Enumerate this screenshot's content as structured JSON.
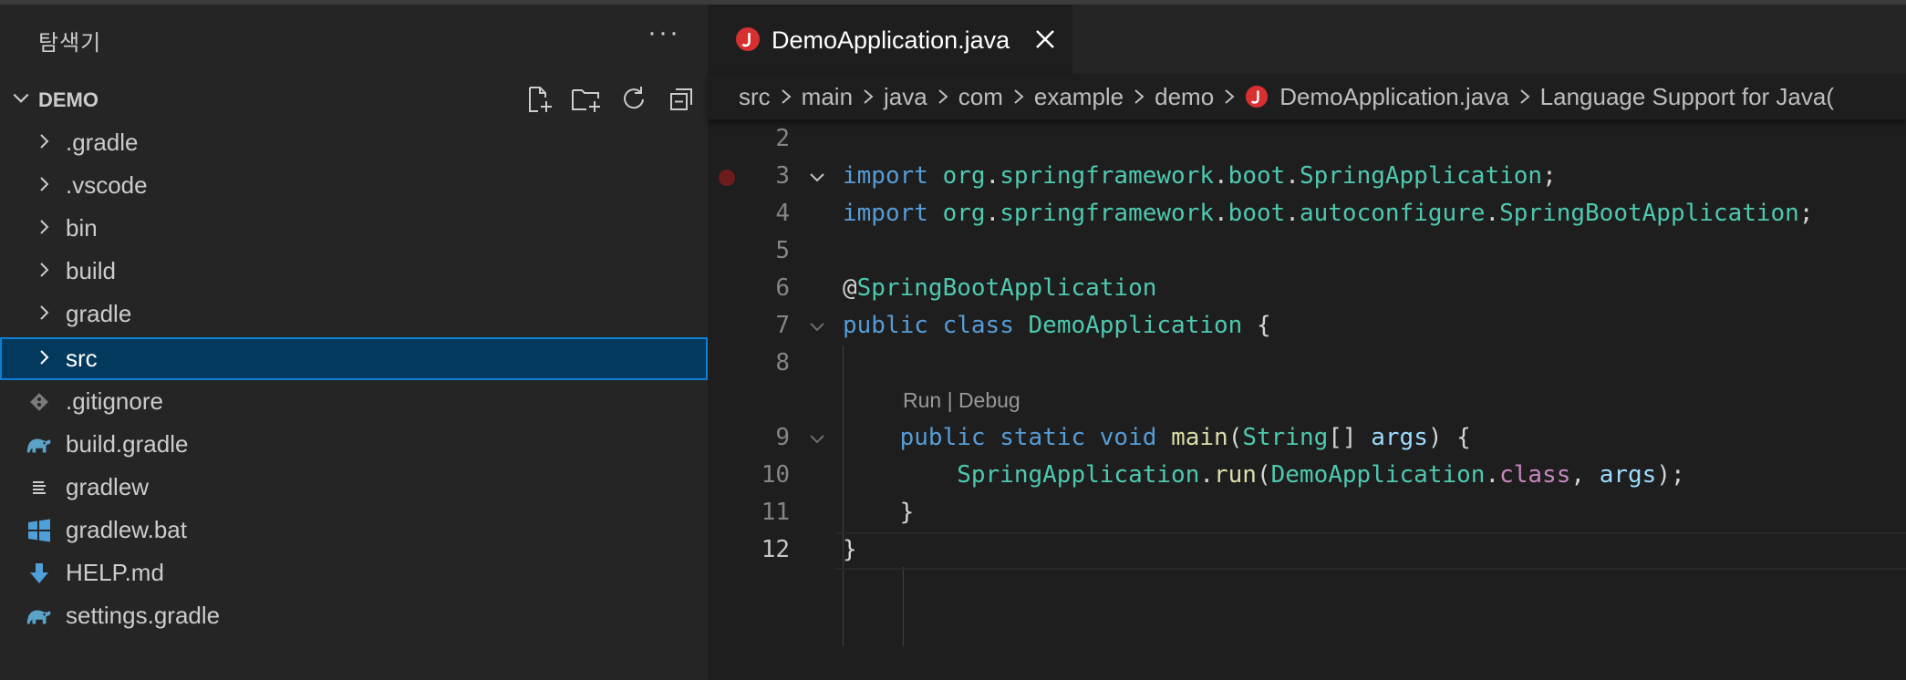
{
  "sidebar": {
    "title": "탐색기",
    "more": "···",
    "section_title": "DEMO",
    "items": [
      {
        "label": ".gradle",
        "type": "folder"
      },
      {
        "label": ".vscode",
        "type": "folder"
      },
      {
        "label": "bin",
        "type": "folder"
      },
      {
        "label": "build",
        "type": "folder"
      },
      {
        "label": "gradle",
        "type": "folder"
      },
      {
        "label": "src",
        "type": "folder",
        "selected": true
      },
      {
        "label": ".gitignore",
        "type": "git-icon"
      },
      {
        "label": "build.gradle",
        "type": "gradle-elephant-icon"
      },
      {
        "label": "gradlew",
        "type": "lines-icon"
      },
      {
        "label": "gradlew.bat",
        "type": "windows-icon"
      },
      {
        "label": "HELP.md",
        "type": "markdown-down-arrow-icon"
      },
      {
        "label": "settings.gradle",
        "type": "gradle-elephant-icon"
      }
    ]
  },
  "tab": {
    "label": "DemoApplication.java",
    "icon": "java-icon"
  },
  "breadcrumb": [
    "src",
    "main",
    "java",
    "com",
    "example",
    "demo",
    "DemoApplication.java",
    "Language Support for Java("
  ],
  "codelens": "Run | Debug",
  "lines": {
    "n2": "2",
    "n3": "3",
    "n4": "4",
    "n5": "5",
    "n6": "6",
    "n7": "7",
    "n8": "8",
    "n9": "9",
    "n10": "10",
    "n11": "11",
    "n12": "12"
  },
  "code": {
    "import": "import",
    "org": "org",
    "dot": ".",
    "springframework": "springframework",
    "boot": "boot",
    "SpringApplication": "SpringApplication",
    "semi": ";",
    "autoconfigure": "autoconfigure",
    "SpringBootApplication": "SpringBootApplication",
    "at": "@",
    "public": "public",
    "class": "class",
    "DemoApplication": "DemoApplication",
    "lbrace": " {",
    "static": "static",
    "void": "void",
    "main": "main",
    "lparen": "(",
    "String": "String",
    "brackets": "[] ",
    "args": "args",
    "rparen_brace": ") {",
    "run": "run",
    "comma": ", ",
    "close_call": ");",
    "rbrace": "}"
  },
  "colors": {
    "accent": "#0e7fd4",
    "selection": "#04395e",
    "java_icon": "#d63031",
    "breakpoint": "#6e1b1b"
  }
}
